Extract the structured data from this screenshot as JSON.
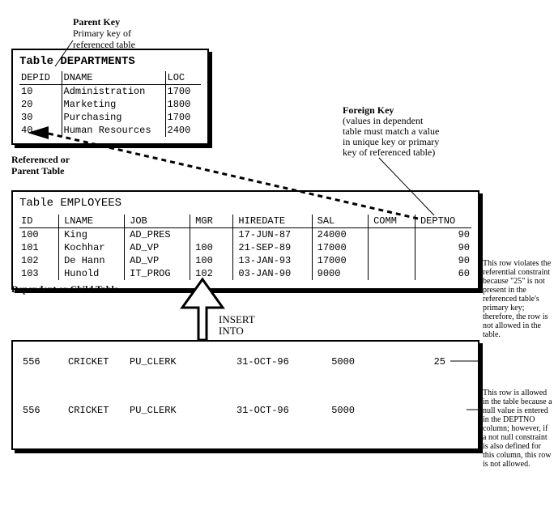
{
  "labels": {
    "parentKey": {
      "l1": "Parent Key",
      "l2": "Primary key of",
      "l3": "referenced table"
    },
    "refParent": {
      "l1": "Referenced or",
      "l2": "Parent Table"
    },
    "foreignKey": {
      "h": "Foreign Key",
      "l1": "(values in dependent",
      "l2": "table must match a value",
      "l3": "in unique key or primary",
      "l4": "key of referenced table)"
    },
    "depChild": "Dependent or Child Table",
    "insertInto": {
      "l1": "INSERT",
      "l2": "INTO"
    }
  },
  "departments": {
    "title": "Table DEPARTMENTS",
    "cols": [
      "DEPID",
      "DNAME",
      "LOC"
    ],
    "rows": [
      {
        "id": "10",
        "name": "Administration",
        "loc": "1700"
      },
      {
        "id": "20",
        "name": "Marketing",
        "loc": "1800"
      },
      {
        "id": "30",
        "name": "Purchasing",
        "loc": "1700"
      },
      {
        "id": "40",
        "name": "Human Resources",
        "loc": "2400"
      }
    ]
  },
  "employees": {
    "title": "Table EMPLOYEES",
    "cols": [
      "ID",
      "LNAME",
      "JOB",
      "MGR",
      "HIREDATE",
      "SAL",
      "COMM",
      "DEPTNO"
    ],
    "rows": [
      {
        "id": "100",
        "lname": "King",
        "job": "AD_PRES",
        "mgr": "",
        "hdate": "17-JUN-87",
        "sal": "24000",
        "comm": "",
        "dept": "90"
      },
      {
        "id": "101",
        "lname": "Kochhar",
        "job": "AD_VP",
        "mgr": "100",
        "hdate": "21-SEP-89",
        "sal": "17000",
        "comm": "",
        "dept": "90"
      },
      {
        "id": "102",
        "lname": "De Hann",
        "job": "AD_VP",
        "mgr": "100",
        "hdate": "13-JAN-93",
        "sal": "17000",
        "comm": "",
        "dept": "90"
      },
      {
        "id": "103",
        "lname": "Hunold",
        "job": "IT_PROG",
        "mgr": "102",
        "hdate": "03-JAN-90",
        "sal": "9000",
        "comm": "",
        "dept": "60"
      }
    ]
  },
  "inserts": {
    "row1": {
      "id": "556",
      "lname": "CRICKET",
      "job": "PU_CLERK",
      "mgr": "",
      "hdate": "31-OCT-96",
      "sal": "5000",
      "comm": "",
      "dept": "25"
    },
    "row2": {
      "id": "556",
      "lname": "CRICKET",
      "job": "PU_CLERK",
      "mgr": "",
      "hdate": "31-OCT-96",
      "sal": "5000",
      "comm": "",
      "dept": ""
    }
  },
  "notes": {
    "n1": "This row violates the referential constraint because \"25\" is not present in the referenced table's primary key; therefore, the row is not allowed in the table.",
    "n2": "This row is allowed in the table because a null value is entered in the DEPTNO column; however, if a not null constraint is also defined for this column, this row is not allowed."
  }
}
